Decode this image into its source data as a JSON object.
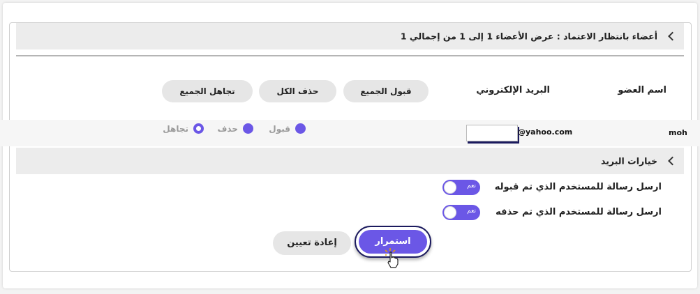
{
  "pending_header": {
    "title": "أعضاء بانتظار الاعتماد : عرض الأعضاء 1 إلى 1 من إجمالي 1"
  },
  "columns": {
    "member_name": "اسم العضو",
    "email": "البريد الإلكتروني"
  },
  "bulk_actions": {
    "accept_all": "قبول الجميع",
    "delete_all": "حذف الكل",
    "ignore_all": "تجاهل الجميع"
  },
  "members": [
    {
      "username": "moh",
      "email_domain": "@yahoo.com",
      "options": {
        "accept": "قبول",
        "delete": "حذف",
        "ignore": "تجاهل"
      },
      "selected": "ignore"
    }
  ],
  "mail_options": {
    "title": "خيارات البريد",
    "send_accepted": "ارسل رسالة للمستخدم الذي تم قبوله",
    "send_deleted": "ارسل رسالة للمستخدم الذي تم حذفه",
    "toggle_label": "نعم"
  },
  "buttons": {
    "continue": "استمرار",
    "reset": "إعادة تعيين"
  },
  "colors": {
    "accent": "#6b57e6",
    "outline": "#1b1a5e",
    "bar_bg": "#ececec"
  }
}
